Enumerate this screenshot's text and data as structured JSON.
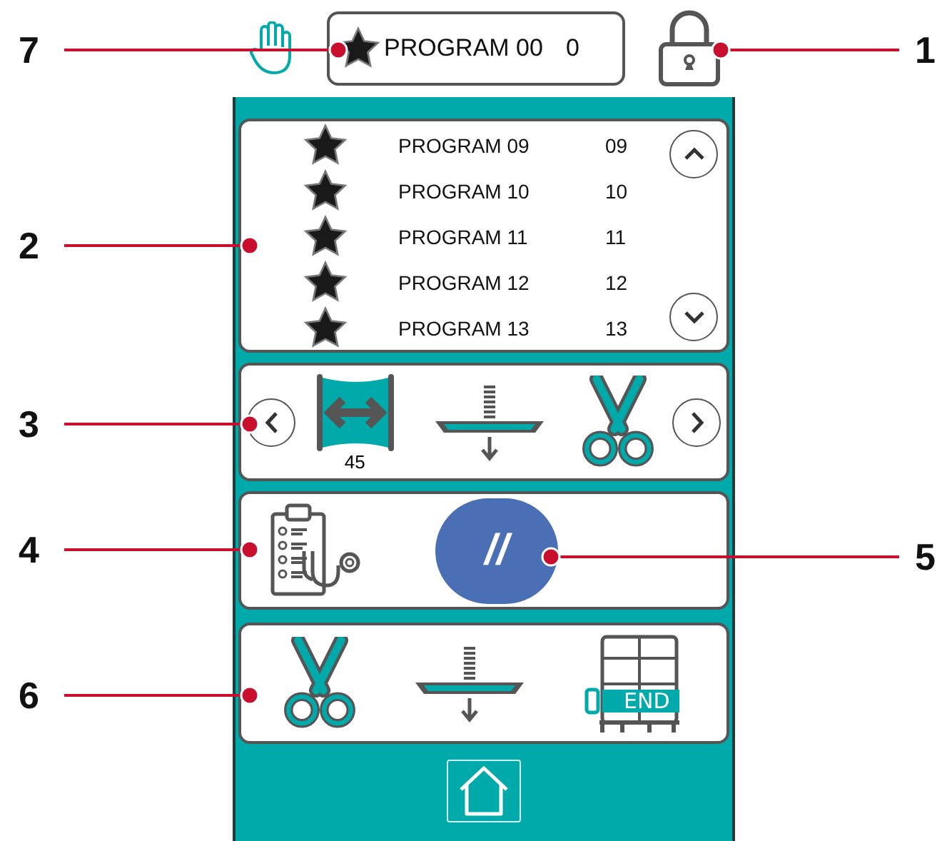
{
  "header": {
    "program": {
      "name": "PROGRAM 00",
      "number": "0"
    }
  },
  "program_list": [
    {
      "name": "PROGRAM 09",
      "number": "09"
    },
    {
      "name": "PROGRAM 10",
      "number": "10"
    },
    {
      "name": "PROGRAM 11",
      "number": "11"
    },
    {
      "name": "PROGRAM 12",
      "number": "12"
    },
    {
      "name": "PROGRAM 13",
      "number": "13"
    }
  ],
  "function_bar": [
    {
      "kind": "stretch",
      "value": "45"
    },
    {
      "kind": "press"
    },
    {
      "kind": "cut"
    }
  ],
  "bottom_bar": [
    {
      "kind": "cut"
    },
    {
      "kind": "press"
    },
    {
      "kind": "end",
      "label": "END"
    }
  ],
  "pause_button": {
    "label": "//"
  },
  "callouts": [
    {
      "label": "7"
    },
    {
      "label": "1"
    },
    {
      "label": "2"
    },
    {
      "label": "3"
    },
    {
      "label": "4"
    },
    {
      "label": "5"
    },
    {
      "label": "6"
    }
  ]
}
